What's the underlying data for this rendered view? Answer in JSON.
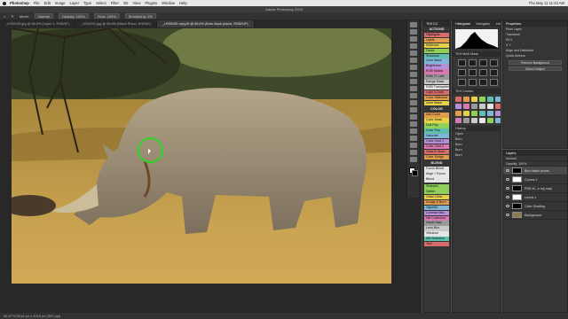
{
  "menubar": {
    "app": "Photoshop",
    "items": [
      "File",
      "Edit",
      "Image",
      "Layer",
      "Type",
      "Select",
      "Filter",
      "3D",
      "View",
      "Plugins",
      "Window",
      "Help"
    ],
    "clock": "Thu May 11  11:43 AM"
  },
  "window": {
    "title": "Adobe Photoshop 2023"
  },
  "options": {
    "mode_label": "Mode:",
    "mode_value": "Normal",
    "opacity": "Opacity: 100%",
    "flow": "Flow: 100%",
    "smoothing": "Smoothing: 0%"
  },
  "tabs": [
    {
      "label": "_LR05195.jpg @ 66.6% (Layer 1, RGB/8*)"
    },
    {
      "label": "_LR04231.jpg @ 66.6% (Black Rhino, RGB/8*)"
    },
    {
      "label": "_LR05195 copy.tif @ 66.6% (Burn black points, RGB/16*)"
    }
  ],
  "status": "66.67%    6016 px x 4016 px (300 ppi)",
  "panels": {
    "actions_tab": "TK9 CC",
    "actions_title": "ACTIONS",
    "actions": [
      {
        "label": "Highlights",
        "color": "#d96b6b"
      },
      {
        "label": "Lights",
        "color": "#e39b4d"
      },
      {
        "label": "Midtones",
        "color": "#e7d04a"
      },
      {
        "label": "Darks",
        "color": "#8fcf5a"
      },
      {
        "label": "Shadows",
        "color": "#5fbfae"
      },
      {
        "label": "Zone Mask",
        "color": "#7fb6d8"
      },
      {
        "label": "Brightness",
        "color": "#b490d8"
      },
      {
        "label": "RGB Masks",
        "color": "#d979b3"
      },
      {
        "label": "RGB 7T LAB",
        "color": "#9a9a9a"
      },
      {
        "label": "Range Mask",
        "color": "#c9c9c9"
      },
      {
        "label": "RGB Transparent",
        "color": "#e6e6e6"
      },
      {
        "label": "Light & Dark",
        "color": "#d96b6b"
      },
      {
        "label": "Color Midtones",
        "color": "#e39b4d"
      },
      {
        "label": "Zone Mask",
        "color": "#e7d04a"
      }
    ],
    "color_title": "COLOR",
    "color_actions": [
      {
        "label": "Add Color",
        "color": "#e39b4d"
      },
      {
        "label": "Color Mask",
        "color": "#e7d04a"
      },
      {
        "label": "Dull Pop",
        "color": "#8fcf5a"
      },
      {
        "label": "Color Pop",
        "color": "#5fbfae"
      },
      {
        "label": "Saturate",
        "color": "#7fb6d8"
      },
      {
        "label": "Color Cast 1",
        "color": "#b490d8"
      },
      {
        "label": "Color Cast 2",
        "color": "#d979b3"
      },
      {
        "label": "Glow & Glow",
        "color": "#d96b6b"
      },
      {
        "label": "Color Dodge",
        "color": "#e39b4d"
      }
    ],
    "blend_title": "BLEND",
    "blend_actions": [
      {
        "label": "Focus Blend",
        "color": "#e6e6e6"
      },
      {
        "label": "Align + Focus",
        "color": "#e6e6e6"
      },
      {
        "label": "Blend",
        "color": "#e6e6e6"
      }
    ],
    "extra_actions": [
      {
        "label": "Sharpen",
        "color": "#8fcf5a"
      },
      {
        "label": "Soften",
        "color": "#8fcf5a"
      },
      {
        "label": "Ortan Glow",
        "color": "#e7d04a"
      },
      {
        "label": "Dodge & Burn",
        "color": "#e39b4d"
      },
      {
        "label": "Vignette",
        "color": "#7fb6d8"
      },
      {
        "label": "Luminar Neo",
        "color": "#b490d8"
      },
      {
        "label": "Nik Collection",
        "color": "#d979b3"
      },
      {
        "label": "Depth Map",
        "color": "#9a9a9a"
      },
      {
        "label": "Lens Blur",
        "color": "#c9c9c9"
      },
      {
        "label": "Vibrance",
        "color": "#e6e6e6"
      },
      {
        "label": "Wb Selective",
        "color": "#5fbfae"
      },
      {
        "label": "Text",
        "color": "#d96b6b"
      }
    ],
    "histogram_tabs": [
      "Histogram",
      "Navigator",
      "Info"
    ],
    "tk_multi_mask": "TK9 Multi Mask",
    "tk_combo": "TK9 Combo",
    "history_tab": "History",
    "history_items": [
      "Open",
      "Burn",
      "Burn",
      "Burn",
      "Burn"
    ],
    "properties_tab": "Properties",
    "props_rows": [
      "Pixel Layer",
      "Transform",
      "W  H",
      "X  Y",
      "Align and Distribute",
      "Quick Actions",
      "Remove Background",
      "Select Subject"
    ],
    "layers_tab": "Layers",
    "layers_blend": "Normal",
    "layers_opacity": "Opacity: 100%",
    "layers": [
      {
        "name": "Burn black points",
        "thumb": "dark",
        "selected": true
      },
      {
        "name": "Curves 1",
        "thumb": "white",
        "selected": false
      },
      {
        "name": "RGB  M...e  mg  map",
        "thumb": "dark",
        "selected": false
      },
      {
        "name": "Levels 1",
        "thumb": "white",
        "selected": false
      },
      {
        "name": "Color Shading",
        "thumb": "dark",
        "selected": false
      },
      {
        "name": "Background",
        "thumb": "photo",
        "selected": false
      }
    ]
  },
  "colors": {
    "accent_ring": "#2bd626"
  }
}
